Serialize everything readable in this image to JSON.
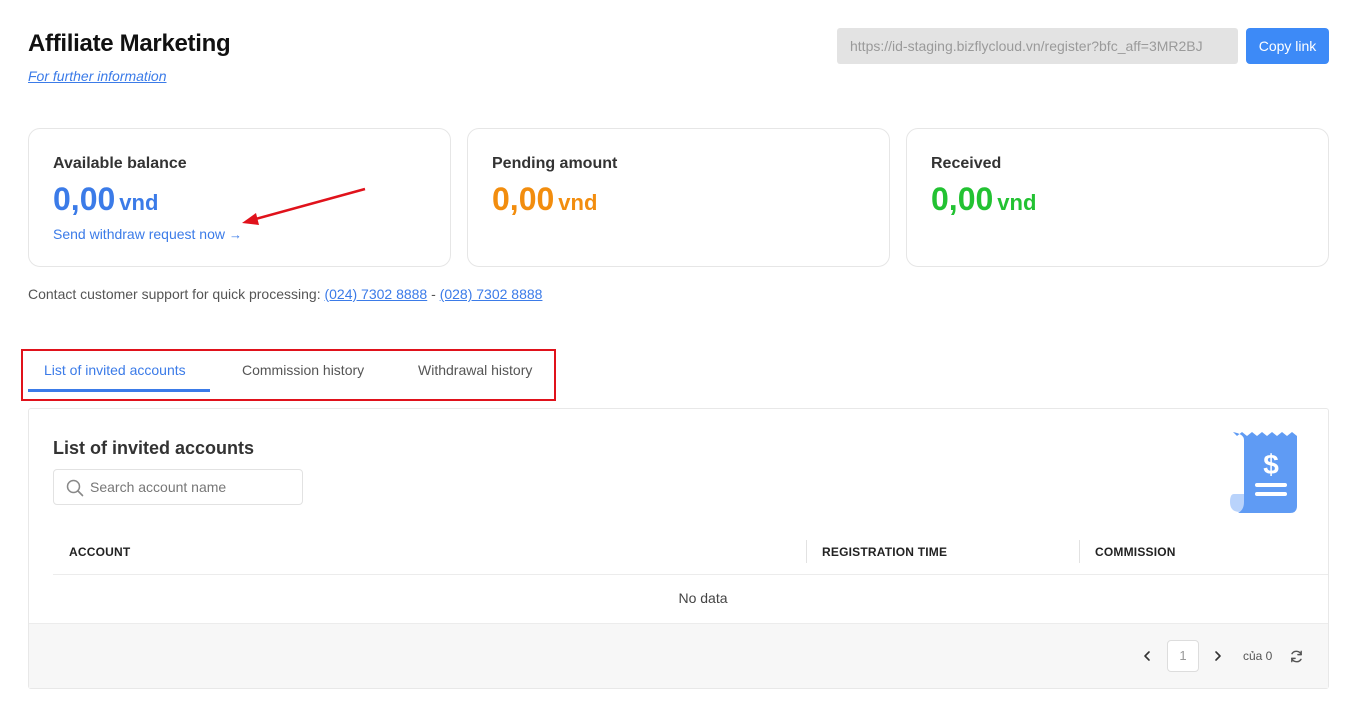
{
  "header": {
    "title": "Affiliate Marketing",
    "info_link": "For further information",
    "referral_url": "https://id-staging.bizflycloud.vn/register?bfc_aff=3MR2BJ",
    "copy_label": "Copy link"
  },
  "cards": [
    {
      "label": "Available balance",
      "amount": "0,00",
      "unit": "vnd",
      "color": "#3b7be8",
      "action": "Send withdraw request now"
    },
    {
      "label": "Pending amount",
      "amount": "0,00",
      "unit": "vnd",
      "color": "#f28d0e"
    },
    {
      "label": "Received",
      "amount": "0,00",
      "unit": "vnd",
      "color": "#22c232"
    }
  ],
  "support": {
    "text": "Contact customer support for quick processing:",
    "phone1": "(024) 7302 8888",
    "separator": "-",
    "phone2": "(028) 7302 8888"
  },
  "tabs": [
    {
      "label": "List of invited accounts",
      "active": true
    },
    {
      "label": "Commission history",
      "active": false
    },
    {
      "label": "Withdrawal history",
      "active": false
    }
  ],
  "panel": {
    "title": "List of invited accounts",
    "search_placeholder": "Search account name",
    "columns": [
      "ACCOUNT",
      "REGISTRATION TIME",
      "COMMISSION"
    ],
    "empty_text": "No data",
    "icon": "receipt-dollar-icon"
  },
  "pagination": {
    "current_page": "1",
    "total_text": "của 0"
  },
  "annotation_color": "#e0121b"
}
